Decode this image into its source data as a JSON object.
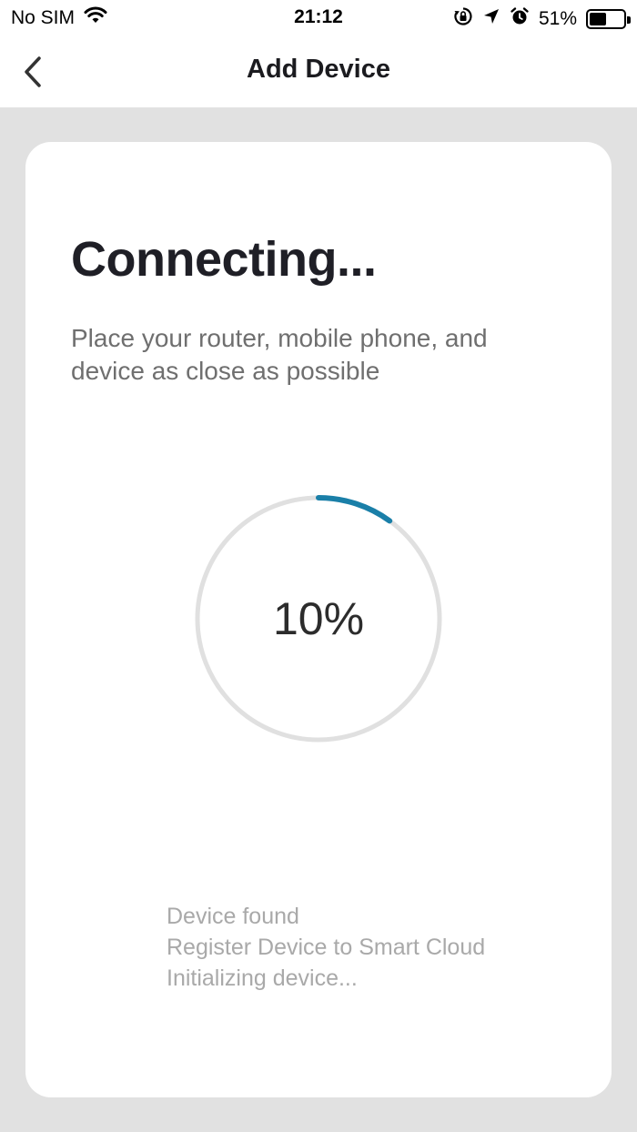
{
  "status_bar": {
    "carrier": "No SIM",
    "time": "21:12",
    "battery_percent": "51%",
    "battery_level": 0.51,
    "icons": [
      "wifi-icon",
      "orientation-lock-icon",
      "location-arrow-icon",
      "alarm-icon",
      "battery-icon"
    ]
  },
  "nav": {
    "title": "Add Device",
    "back_icon": "chevron-left-icon"
  },
  "main": {
    "heading": "Connecting...",
    "subtitle": "Place your router, mobile phone, and device as close as possible",
    "progress": {
      "label": "10%",
      "value": 0.1
    },
    "steps": [
      "Device found",
      "Register Device to Smart Cloud",
      "Initializing device..."
    ]
  },
  "colors": {
    "accent": "#1a7fa8",
    "track": "#e0e0e0",
    "background": "#e1e1e1",
    "card": "#ffffff"
  }
}
